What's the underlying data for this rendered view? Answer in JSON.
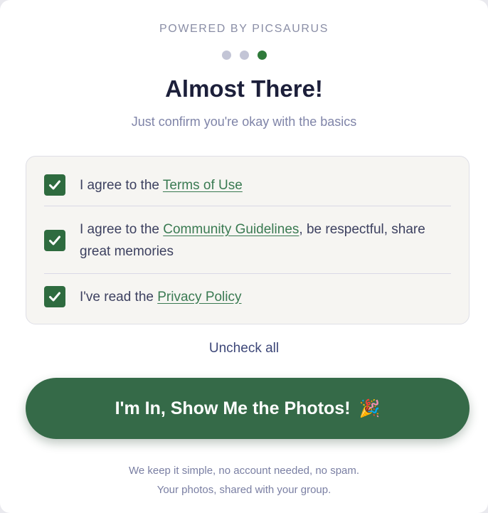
{
  "header": {
    "powered_by": "POWERED BY PICSAURUS",
    "title": "Almost There!",
    "subtitle": "Just confirm you're okay with the basics"
  },
  "progress": {
    "steps_total": 3,
    "current_step": 3
  },
  "consents": [
    {
      "prefix": "I agree to the ",
      "link": "Terms of Use",
      "suffix": "",
      "checked": true
    },
    {
      "prefix": "I agree to the ",
      "link": "Community Guidelines",
      "suffix": ", be respectful, share great memories",
      "checked": true
    },
    {
      "prefix": "I've read the ",
      "link": "Privacy Policy",
      "suffix": "",
      "checked": true
    }
  ],
  "uncheck_all_label": "Uncheck all",
  "cta": {
    "label": "I'm In, Show Me the Photos!",
    "emoji": "🎉"
  },
  "footer": {
    "line1": "We keep it simple, no account needed, no spam.",
    "line2": "Your photos, shared with your group."
  },
  "colors": {
    "accent": "#2f7a3a",
    "button": "#356a48",
    "title": "#1c1f3a",
    "muted": "#7f84a8"
  },
  "icons": {
    "checkbox": "checkmark-icon",
    "cta": "party-popper-icon"
  }
}
